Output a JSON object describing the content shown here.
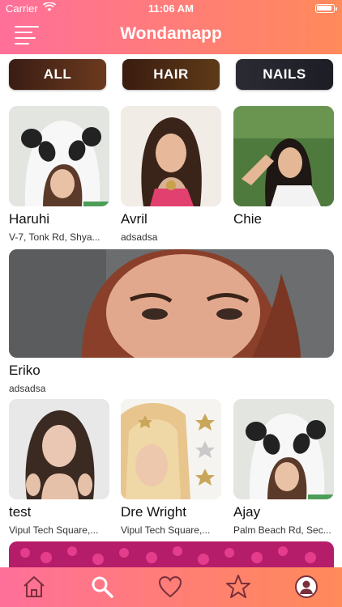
{
  "status_bar": {
    "carrier": "Carrier",
    "time": "11:06 AM"
  },
  "header": {
    "title": "Wondamapp"
  },
  "categories": [
    {
      "label": "ALL"
    },
    {
      "label": "HAIR"
    },
    {
      "label": "NAILS"
    }
  ],
  "providers": [
    {
      "name": "Haruhi",
      "address": "V-7, Tonk Rd, Shya..."
    },
    {
      "name": "Avril",
      "address": "adsadsa"
    },
    {
      "name": "Chie",
      "address": ""
    },
    {
      "name": "Eriko",
      "address": "adsadsa"
    },
    {
      "name": "test",
      "address": "Vipul Tech Square,..."
    },
    {
      "name": "Dre Wright",
      "address": "Vipul Tech Square,..."
    },
    {
      "name": "Ajay",
      "address": "Palm Beach Rd, Sec..."
    }
  ],
  "tabs": [
    {
      "icon": "home-icon"
    },
    {
      "icon": "search-icon"
    },
    {
      "icon": "heart-icon"
    },
    {
      "icon": "star-icon"
    },
    {
      "icon": "profile-icon"
    }
  ],
  "colors": {
    "header_gradient_start": "#ff6f9a",
    "header_gradient_end": "#ff8a5a",
    "active_tab": "#ffffff"
  }
}
